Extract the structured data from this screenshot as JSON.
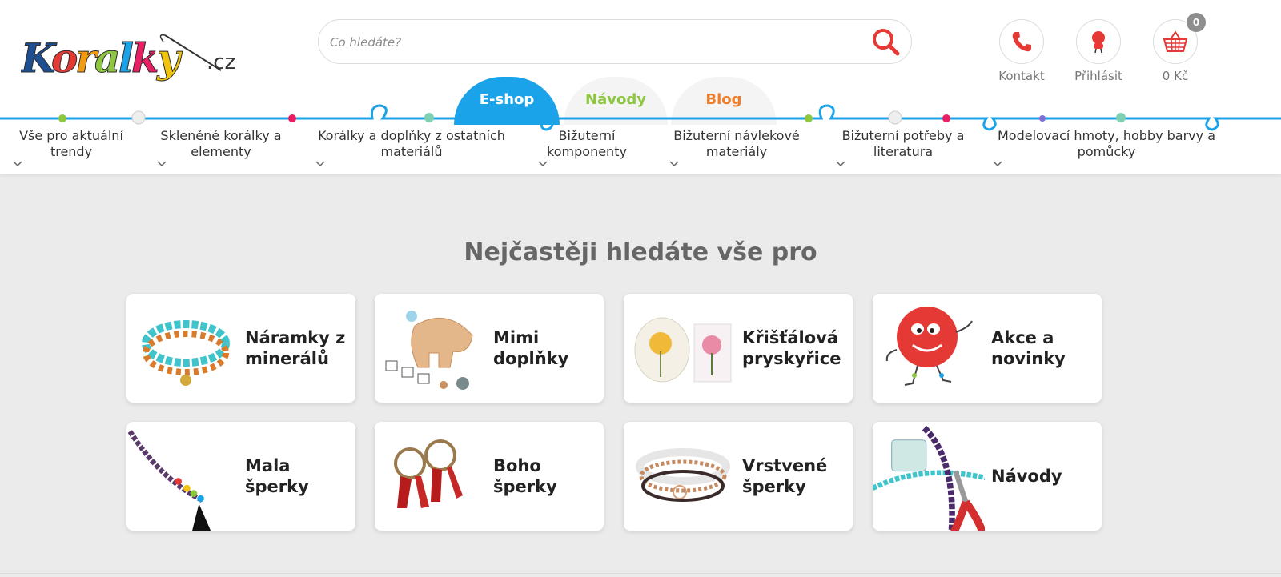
{
  "header": {
    "logo_text": "Koralky",
    "logo_domain": ".cz",
    "search": {
      "placeholder": "Co hledáte?"
    },
    "actions": [
      {
        "label": "Kontakt",
        "icon": "phone-icon"
      },
      {
        "label": "Přihlásit",
        "icon": "user-icon"
      },
      {
        "label": "0 Kč",
        "icon": "basket-icon",
        "badge": "0"
      }
    ]
  },
  "tabs": [
    {
      "label": "E-shop",
      "active": true,
      "color": "#1aa3e8"
    },
    {
      "label": "Návody",
      "active": false,
      "color": "#8dc63f"
    },
    {
      "label": "Blog",
      "active": false,
      "color": "#f07d28"
    }
  ],
  "categories": [
    {
      "line1": "Vše pro aktuální",
      "line2": "trendy"
    },
    {
      "line1": "Skleněné korálky a",
      "line2": "elementy"
    },
    {
      "line1": "Korálky a doplňky z ostatních",
      "line2": "materiálů"
    },
    {
      "line1": "Bižuterní",
      "line2": "komponenty"
    },
    {
      "line1": "Bižuterní návlekové",
      "line2": "materiály"
    },
    {
      "line1": "Bižuterní potřeby a",
      "line2": "literatura"
    },
    {
      "line1": "Modelovací hmoty, hobby barvy a",
      "line2": "pomůcky"
    }
  ],
  "main": {
    "title": "Nejčastěji hledáte vše pro",
    "tiles": [
      {
        "line1": "Náramky z",
        "line2": "minerálů",
        "icon": "bracelet-icon"
      },
      {
        "line1": "Mimi",
        "line2": "doplňky",
        "icon": "teether-icon"
      },
      {
        "line1": "Křišťálová",
        "line2": "pryskyřice",
        "icon": "resin-icon"
      },
      {
        "line1": "Akce a",
        "line2": "novinky",
        "icon": "mascot-icon"
      },
      {
        "line1": "Mala šperky",
        "line2": "",
        "icon": "mala-icon"
      },
      {
        "line1": "Boho",
        "line2": "šperky",
        "icon": "earrings-icon"
      },
      {
        "line1": "Vrstvené",
        "line2": "šperky",
        "icon": "layered-bracelet-icon"
      },
      {
        "line1": "Návody",
        "line2": "",
        "icon": "pliers-icon"
      }
    ]
  },
  "colors": {
    "accent": "#1aa3e8",
    "background": "#ebebeb",
    "search_icon": "#e53935"
  }
}
